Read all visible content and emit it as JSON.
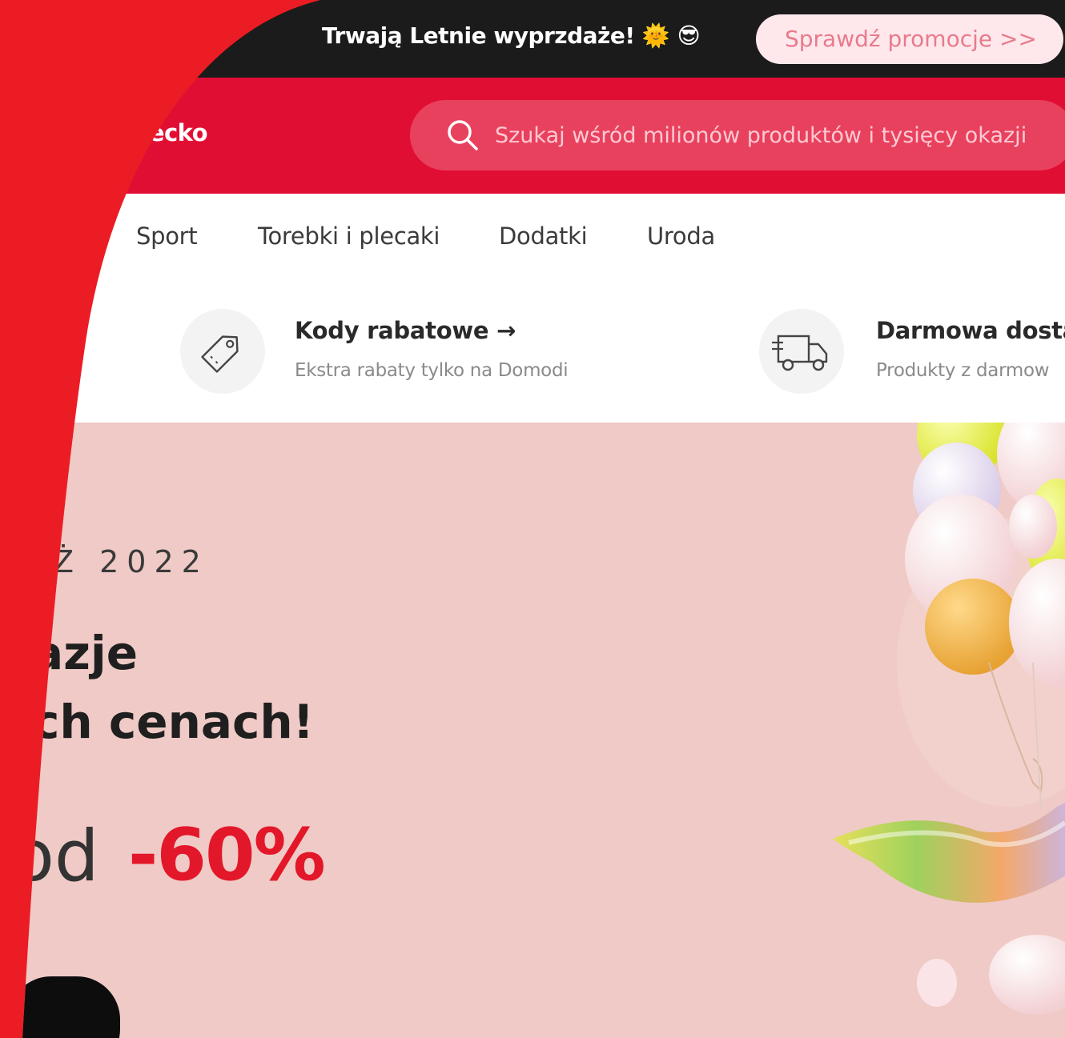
{
  "promo": {
    "text": "Trwają Letnie wyprzdaże! 🌞 😎",
    "button_label": "Sprawdź promocje >>"
  },
  "header": {
    "brand": "ziecko",
    "search_placeholder": "Szukaj wśród milionów produktów i tysięcy okazji"
  },
  "categories": [
    "Sport",
    "Torebki i plecaki",
    "Dodatki",
    "Uroda"
  ],
  "features": [
    {
      "icon": "price-tag-icon",
      "title": "Kody rabatowe →",
      "subtitle": "Ekstra rabaty tylko na Domodi"
    },
    {
      "icon": "delivery-truck-icon",
      "title": "Darmowa dosta",
      "subtitle": "Produkty z darmow"
    }
  ],
  "hero": {
    "date": "Ż 2022",
    "line1": "azje",
    "line2": "ch cenach!",
    "discount_prefix": "od",
    "discount_value": "-60%"
  },
  "colors": {
    "frame": "#ec1c24",
    "header": "#e10e34",
    "promo_bar": "#1b1b1b",
    "hero_bg": "#f0cac6",
    "accent": "#e3172a"
  }
}
